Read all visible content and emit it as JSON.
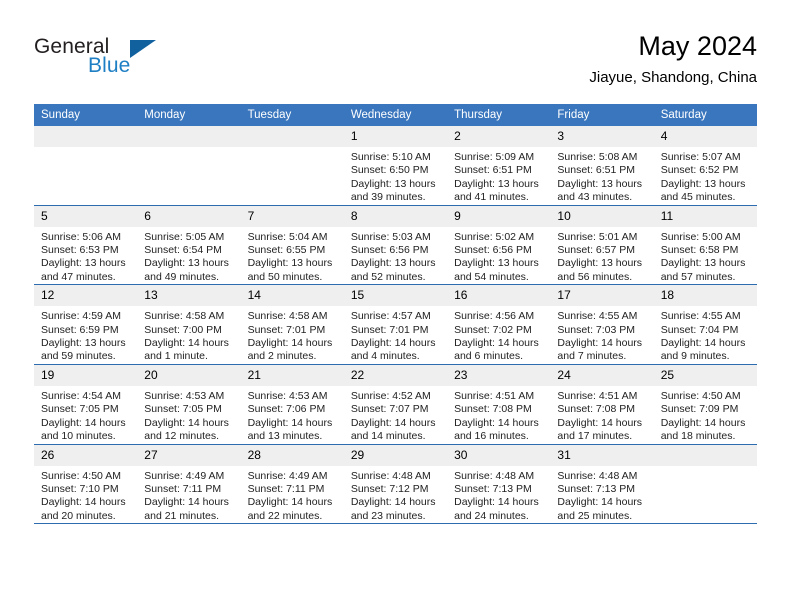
{
  "brand": {
    "name_part1": "General",
    "name_part2": "Blue",
    "triangle_color": "#11619e",
    "blue_text_color": "#1f7fc4"
  },
  "header": {
    "month_title": "May 2024",
    "location": "Jiayue, Shandong, China",
    "header_bg_color": "#3a76bd",
    "grid_line_color": "#2e6cb0",
    "daynum_bg_color": "#efefef"
  },
  "weekdays": [
    "Sunday",
    "Monday",
    "Tuesday",
    "Wednesday",
    "Thursday",
    "Friday",
    "Saturday"
  ],
  "weeks": [
    [
      {
        "day": "",
        "blank": true
      },
      {
        "day": "",
        "blank": true
      },
      {
        "day": "",
        "blank": true
      },
      {
        "day": "1",
        "sunrise": "Sunrise: 5:10 AM",
        "sunset": "Sunset: 6:50 PM",
        "daylight_line1": "Daylight: 13 hours",
        "daylight_line2": "and 39 minutes."
      },
      {
        "day": "2",
        "sunrise": "Sunrise: 5:09 AM",
        "sunset": "Sunset: 6:51 PM",
        "daylight_line1": "Daylight: 13 hours",
        "daylight_line2": "and 41 minutes."
      },
      {
        "day": "3",
        "sunrise": "Sunrise: 5:08 AM",
        "sunset": "Sunset: 6:51 PM",
        "daylight_line1": "Daylight: 13 hours",
        "daylight_line2": "and 43 minutes."
      },
      {
        "day": "4",
        "sunrise": "Sunrise: 5:07 AM",
        "sunset": "Sunset: 6:52 PM",
        "daylight_line1": "Daylight: 13 hours",
        "daylight_line2": "and 45 minutes."
      }
    ],
    [
      {
        "day": "5",
        "sunrise": "Sunrise: 5:06 AM",
        "sunset": "Sunset: 6:53 PM",
        "daylight_line1": "Daylight: 13 hours",
        "daylight_line2": "and 47 minutes."
      },
      {
        "day": "6",
        "sunrise": "Sunrise: 5:05 AM",
        "sunset": "Sunset: 6:54 PM",
        "daylight_line1": "Daylight: 13 hours",
        "daylight_line2": "and 49 minutes."
      },
      {
        "day": "7",
        "sunrise": "Sunrise: 5:04 AM",
        "sunset": "Sunset: 6:55 PM",
        "daylight_line1": "Daylight: 13 hours",
        "daylight_line2": "and 50 minutes."
      },
      {
        "day": "8",
        "sunrise": "Sunrise: 5:03 AM",
        "sunset": "Sunset: 6:56 PM",
        "daylight_line1": "Daylight: 13 hours",
        "daylight_line2": "and 52 minutes."
      },
      {
        "day": "9",
        "sunrise": "Sunrise: 5:02 AM",
        "sunset": "Sunset: 6:56 PM",
        "daylight_line1": "Daylight: 13 hours",
        "daylight_line2": "and 54 minutes."
      },
      {
        "day": "10",
        "sunrise": "Sunrise: 5:01 AM",
        "sunset": "Sunset: 6:57 PM",
        "daylight_line1": "Daylight: 13 hours",
        "daylight_line2": "and 56 minutes."
      },
      {
        "day": "11",
        "sunrise": "Sunrise: 5:00 AM",
        "sunset": "Sunset: 6:58 PM",
        "daylight_line1": "Daylight: 13 hours",
        "daylight_line2": "and 57 minutes."
      }
    ],
    [
      {
        "day": "12",
        "sunrise": "Sunrise: 4:59 AM",
        "sunset": "Sunset: 6:59 PM",
        "daylight_line1": "Daylight: 13 hours",
        "daylight_line2": "and 59 minutes."
      },
      {
        "day": "13",
        "sunrise": "Sunrise: 4:58 AM",
        "sunset": "Sunset: 7:00 PM",
        "daylight_line1": "Daylight: 14 hours",
        "daylight_line2": "and 1 minute."
      },
      {
        "day": "14",
        "sunrise": "Sunrise: 4:58 AM",
        "sunset": "Sunset: 7:01 PM",
        "daylight_line1": "Daylight: 14 hours",
        "daylight_line2": "and 2 minutes."
      },
      {
        "day": "15",
        "sunrise": "Sunrise: 4:57 AM",
        "sunset": "Sunset: 7:01 PM",
        "daylight_line1": "Daylight: 14 hours",
        "daylight_line2": "and 4 minutes."
      },
      {
        "day": "16",
        "sunrise": "Sunrise: 4:56 AM",
        "sunset": "Sunset: 7:02 PM",
        "daylight_line1": "Daylight: 14 hours",
        "daylight_line2": "and 6 minutes."
      },
      {
        "day": "17",
        "sunrise": "Sunrise: 4:55 AM",
        "sunset": "Sunset: 7:03 PM",
        "daylight_line1": "Daylight: 14 hours",
        "daylight_line2": "and 7 minutes."
      },
      {
        "day": "18",
        "sunrise": "Sunrise: 4:55 AM",
        "sunset": "Sunset: 7:04 PM",
        "daylight_line1": "Daylight: 14 hours",
        "daylight_line2": "and 9 minutes."
      }
    ],
    [
      {
        "day": "19",
        "sunrise": "Sunrise: 4:54 AM",
        "sunset": "Sunset: 7:05 PM",
        "daylight_line1": "Daylight: 14 hours",
        "daylight_line2": "and 10 minutes."
      },
      {
        "day": "20",
        "sunrise": "Sunrise: 4:53 AM",
        "sunset": "Sunset: 7:05 PM",
        "daylight_line1": "Daylight: 14 hours",
        "daylight_line2": "and 12 minutes."
      },
      {
        "day": "21",
        "sunrise": "Sunrise: 4:53 AM",
        "sunset": "Sunset: 7:06 PM",
        "daylight_line1": "Daylight: 14 hours",
        "daylight_line2": "and 13 minutes."
      },
      {
        "day": "22",
        "sunrise": "Sunrise: 4:52 AM",
        "sunset": "Sunset: 7:07 PM",
        "daylight_line1": "Daylight: 14 hours",
        "daylight_line2": "and 14 minutes."
      },
      {
        "day": "23",
        "sunrise": "Sunrise: 4:51 AM",
        "sunset": "Sunset: 7:08 PM",
        "daylight_line1": "Daylight: 14 hours",
        "daylight_line2": "and 16 minutes."
      },
      {
        "day": "24",
        "sunrise": "Sunrise: 4:51 AM",
        "sunset": "Sunset: 7:08 PM",
        "daylight_line1": "Daylight: 14 hours",
        "daylight_line2": "and 17 minutes."
      },
      {
        "day": "25",
        "sunrise": "Sunrise: 4:50 AM",
        "sunset": "Sunset: 7:09 PM",
        "daylight_line1": "Daylight: 14 hours",
        "daylight_line2": "and 18 minutes."
      }
    ],
    [
      {
        "day": "26",
        "sunrise": "Sunrise: 4:50 AM",
        "sunset": "Sunset: 7:10 PM",
        "daylight_line1": "Daylight: 14 hours",
        "daylight_line2": "and 20 minutes."
      },
      {
        "day": "27",
        "sunrise": "Sunrise: 4:49 AM",
        "sunset": "Sunset: 7:11 PM",
        "daylight_line1": "Daylight: 14 hours",
        "daylight_line2": "and 21 minutes."
      },
      {
        "day": "28",
        "sunrise": "Sunrise: 4:49 AM",
        "sunset": "Sunset: 7:11 PM",
        "daylight_line1": "Daylight: 14 hours",
        "daylight_line2": "and 22 minutes."
      },
      {
        "day": "29",
        "sunrise": "Sunrise: 4:48 AM",
        "sunset": "Sunset: 7:12 PM",
        "daylight_line1": "Daylight: 14 hours",
        "daylight_line2": "and 23 minutes."
      },
      {
        "day": "30",
        "sunrise": "Sunrise: 4:48 AM",
        "sunset": "Sunset: 7:13 PM",
        "daylight_line1": "Daylight: 14 hours",
        "daylight_line2": "and 24 minutes."
      },
      {
        "day": "31",
        "sunrise": "Sunrise: 4:48 AM",
        "sunset": "Sunset: 7:13 PM",
        "daylight_line1": "Daylight: 14 hours",
        "daylight_line2": "and 25 minutes."
      },
      {
        "day": "",
        "blank": true
      }
    ]
  ]
}
